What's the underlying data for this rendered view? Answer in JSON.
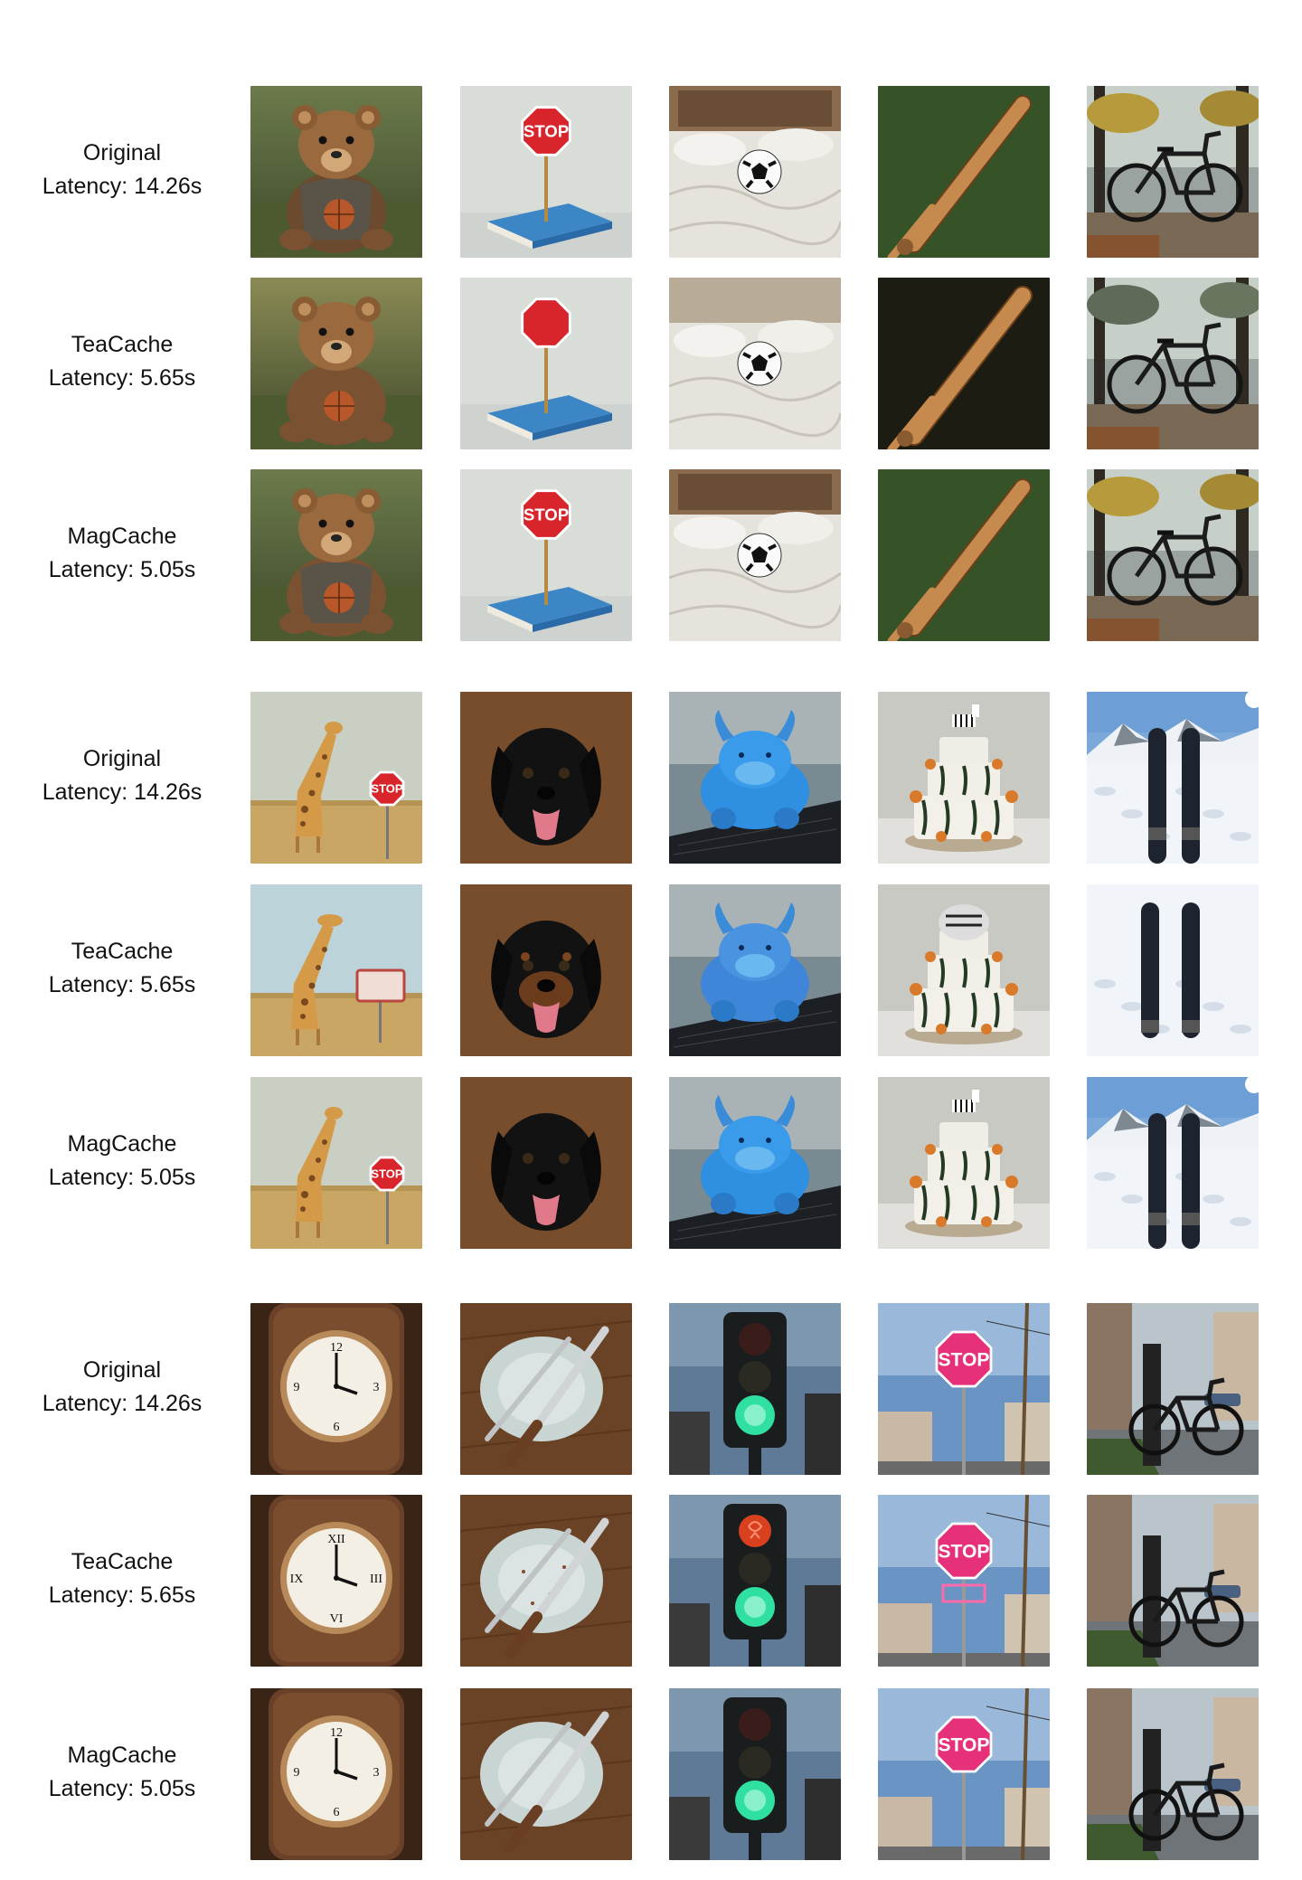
{
  "rows": [
    {
      "method": "Original",
      "latency": "Latency: 14.26s"
    },
    {
      "method": "TeaCache",
      "latency": "Latency: 5.65s"
    },
    {
      "method": "MagCache",
      "latency": "Latency: 5.05s"
    },
    {
      "method": "Original",
      "latency": "Latency: 14.26s"
    },
    {
      "method": "TeaCache",
      "latency": "Latency: 5.65s"
    },
    {
      "method": "MagCache",
      "latency": "Latency: 5.05s"
    },
    {
      "method": "Original",
      "latency": "Latency: 14.26s"
    },
    {
      "method": "TeaCache",
      "latency": "Latency: 5.65s"
    },
    {
      "method": "MagCache",
      "latency": "Latency: 5.05s"
    }
  ],
  "groups": [
    {
      "subjects": [
        "teddy-bear",
        "stop-sign-on-book",
        "soccer-ball-on-bed",
        "baseball-bat",
        "bicycle-autumn"
      ]
    },
    {
      "subjects": [
        "giraffe-stop-sign",
        "black-dog",
        "blue-bull-plush",
        "zebra-cake",
        "skis-snow"
      ]
    },
    {
      "subjects": [
        "clock",
        "plate-fork-knife",
        "traffic-light",
        "pink-stop-sign",
        "bicycle-street"
      ]
    }
  ],
  "sign_text": {
    "stop": "STOP"
  },
  "colors": {
    "background": "#ffffff",
    "stop_red": "#d8252b",
    "stop_pink": "#e6307a",
    "book_blue": "#3d86c6",
    "signal_green": "#2fe0a0"
  }
}
